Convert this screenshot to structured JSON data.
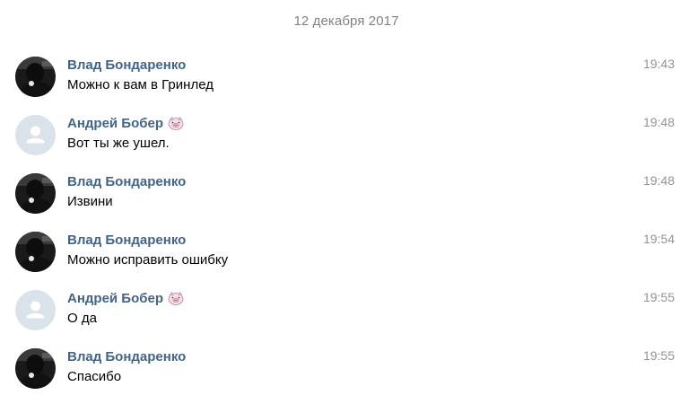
{
  "date_divider": "12 декабря 2017",
  "colors": {
    "author": "#42648b",
    "time": "#939393",
    "date": "#828282",
    "placeholder_bg": "#c5cfdb"
  },
  "messages": [
    {
      "author": "Влад Бондаренко",
      "text": "Можно к вам в Гринлед",
      "time": "19:43",
      "avatar": "photo-avatar",
      "badge": ""
    },
    {
      "author": "Андрей Бобер",
      "text": "Вот ты же ушел.",
      "time": "19:48",
      "avatar": "placeholder-avatar",
      "badge": "pig-emoji"
    },
    {
      "author": "Влад Бондаренко",
      "text": "Извини",
      "time": "19:48",
      "avatar": "photo-avatar",
      "badge": ""
    },
    {
      "author": "Влад Бондаренко",
      "text": "Можно исправить ошибку",
      "time": "19:54",
      "avatar": "photo-avatar",
      "badge": ""
    },
    {
      "author": "Андрей Бобер",
      "text": "О да",
      "time": "19:55",
      "avatar": "placeholder-avatar",
      "badge": "pig-emoji"
    },
    {
      "author": "Влад Бондаренко",
      "text": "Спасибо",
      "time": "19:55",
      "avatar": "photo-avatar",
      "badge": ""
    }
  ]
}
